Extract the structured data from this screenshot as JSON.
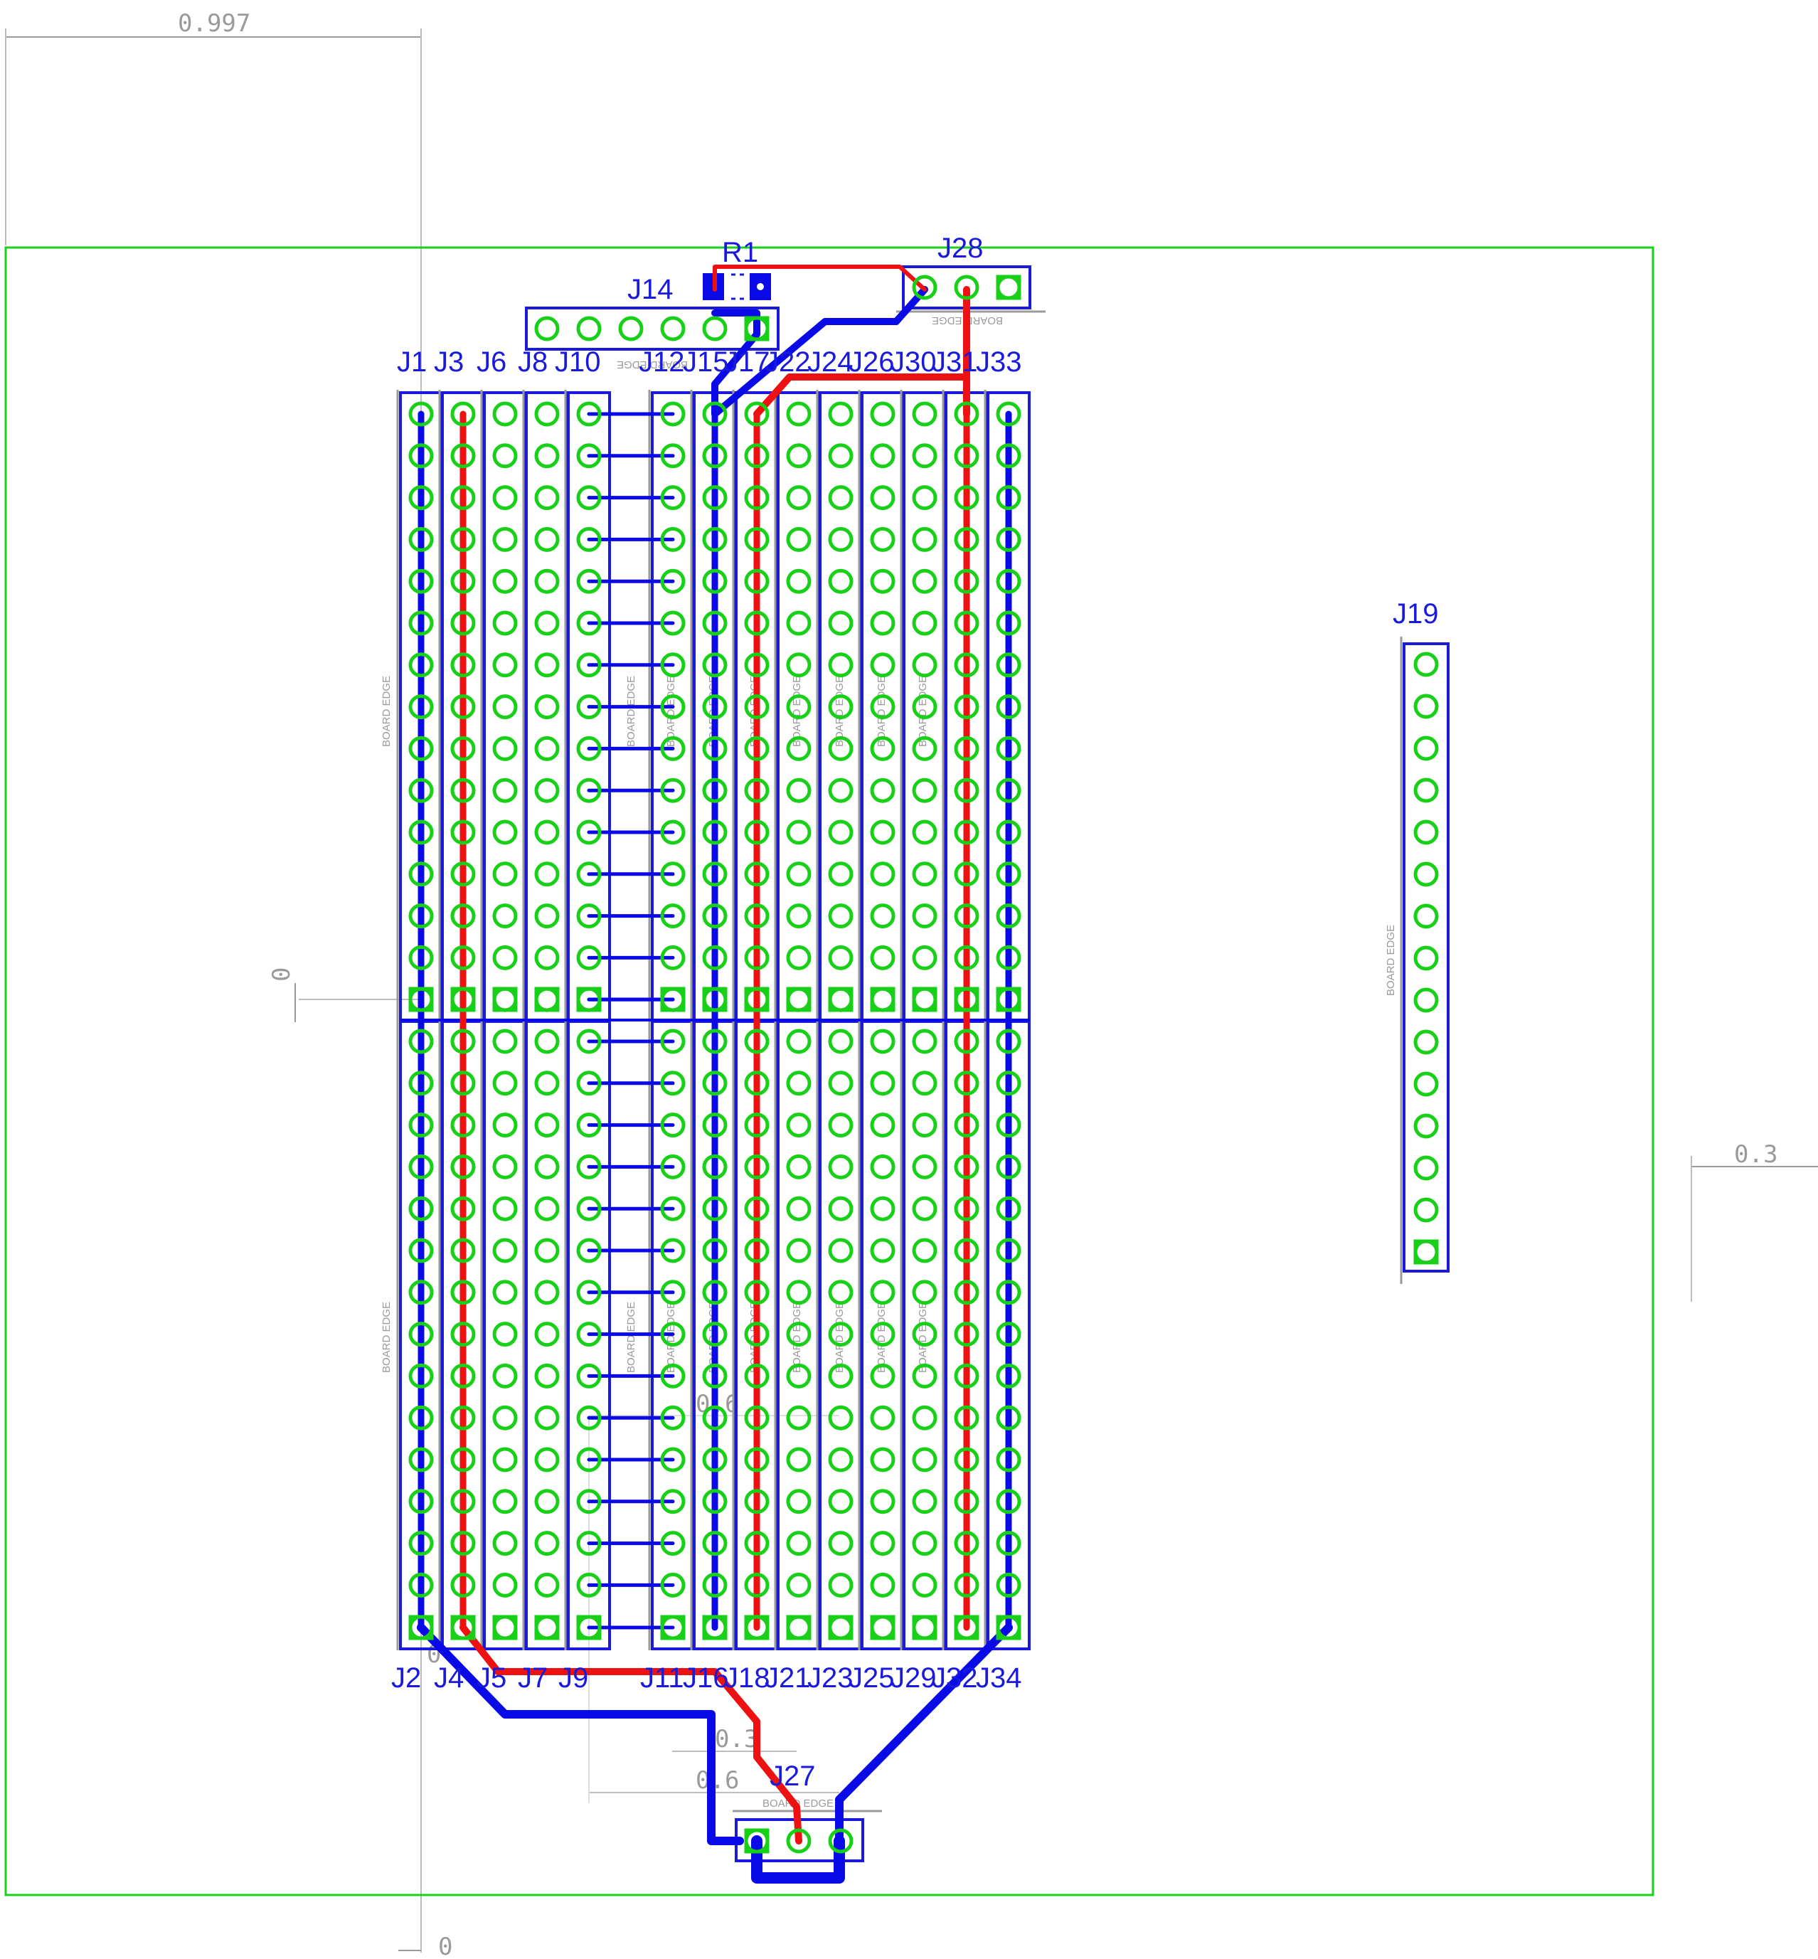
{
  "colors": {
    "board_outline": "#18d018",
    "pad": "#18d018",
    "top_copper": "#ee1111",
    "bottom_copper": "#0a0ae6",
    "silkscreen_outline": "#1a1adc",
    "dimension": "#9a9a9a"
  },
  "dimensions": {
    "top_width": "0.997",
    "left_offset": "0",
    "bottom_offset": "0",
    "right_gap": "0.3",
    "bottom_spacing_a": "0.3",
    "bottom_spacing_b": "0.6",
    "mid_spacing": "0.6",
    "bottom_row_zero": "0"
  },
  "silk_text": {
    "board_edge": "BOARD EDGE"
  },
  "components": {
    "r1": "R1",
    "j14": "J14",
    "j28": "J28",
    "j19": "J19",
    "j27": "J27",
    "top_row_labels": [
      "J1",
      "J3",
      "J6",
      "J8",
      "J10",
      "J12",
      "J15",
      "J17",
      "J22",
      "J24",
      "J26",
      "J30",
      "J31",
      "J33"
    ],
    "bottom_row_labels": [
      "J2",
      "J4",
      "J5",
      "J7",
      "J9",
      "J11",
      "J16",
      "J18",
      "J21",
      "J23",
      "J25",
      "J29",
      "J32",
      "J34"
    ]
  }
}
